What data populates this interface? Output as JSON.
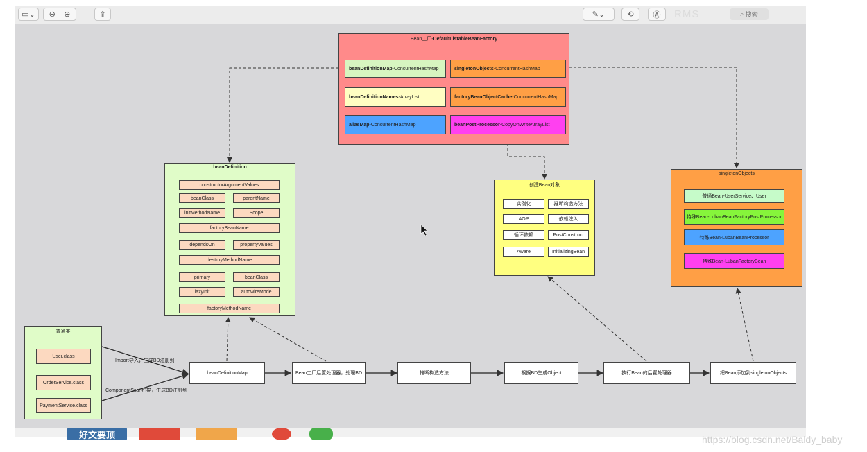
{
  "toolbar": {
    "search_label": "搜索",
    "faded_text": "RMS"
  },
  "factory": {
    "title_prefix": "Bean工厂-",
    "title_bold": "DefaultListableBeanFactory",
    "items": [
      {
        "bold": "beanDefinitionMap",
        "rest": "-ConcurrentHashMap",
        "color": "#d7f5c0"
      },
      {
        "bold": "singletonObjects",
        "rest": "-ConcurrentHashMap",
        "color": "#ff9f45"
      },
      {
        "bold": "beanDefinitionNames",
        "rest": "-ArrayList",
        "color": "#fffec2"
      },
      {
        "bold": "factoryBeanObjectCache",
        "rest": "-ConcurrentHashMap",
        "color": "#ff9f45"
      },
      {
        "bold": "aliasMap",
        "rest": "-ConcurrentHashMap",
        "color": "#4da3ff"
      },
      {
        "bold": "beanPostProcessor",
        "rest": "-CopyOnWriteArrayList",
        "color": "#ff40f0"
      }
    ],
    "color": "#ff8a8a"
  },
  "bean_definition": {
    "title": "beanDefinition",
    "color": "#e0fcc8",
    "item_color": "#fcd9c0",
    "items": {
      "constructor_args": "constructorArgumentValues",
      "bean_class": "beanClass",
      "parent_name": "parentName",
      "init_method": "initMethodName",
      "scope": "Scope",
      "factory_bean_name": "factoryBeanName",
      "depends_on": "dependsOn",
      "property_values": "propertyValues",
      "destroy_method": "destroyMethodName",
      "primary": "primary",
      "bean_class_2": "beanClass",
      "lazy_init": "lazyInit",
      "autowire_mode": "autowireMode",
      "factory_method": "factoryMethodName"
    }
  },
  "create_bean": {
    "title": "创建Bean对象",
    "color": "#ffff80",
    "items": [
      "实例化",
      "推断构造方法",
      "AOP",
      "依赖注入",
      "循环依赖",
      "PostConstruct",
      "Aware",
      "InitializingBean"
    ]
  },
  "singleton_objects": {
    "title": "singletonObjects",
    "color": "#ff9f45",
    "items": [
      {
        "label": "普通Bean-UserService、User",
        "color": "#c6fbc9"
      },
      {
        "label": "特殊Bean-LubanBeanFactoryPostProcessor",
        "color": "#86f53b"
      },
      {
        "label": "特殊Bean-LubanBeanProcessor",
        "color": "#4da3ff"
      },
      {
        "label": "特殊Bean-LubanFactoryBean",
        "color": "#ff40f0"
      }
    ]
  },
  "classes": {
    "title": "普通类",
    "color": "#e0fcc8",
    "item_color": "#fcd9c0",
    "items": [
      "User.class",
      "OrderService.class",
      "PaymentService.class"
    ]
  },
  "flow": {
    "steps": [
      "beanDefinitionMap",
      "Bean工厂后置处理器，处理BD",
      "推断构造方法",
      "根据BD生成Object",
      "执行Bean的后置处理器",
      "把Bean添加到singletonObjects"
    ],
    "import_label": "Import导入，生成BD注册到",
    "scan_label": "ComponentScan扫描，生成BD注册到"
  },
  "bottom": {
    "banner": "好文要顶",
    "watermark": "https://blog.csdn.net/Baldy_baby"
  }
}
